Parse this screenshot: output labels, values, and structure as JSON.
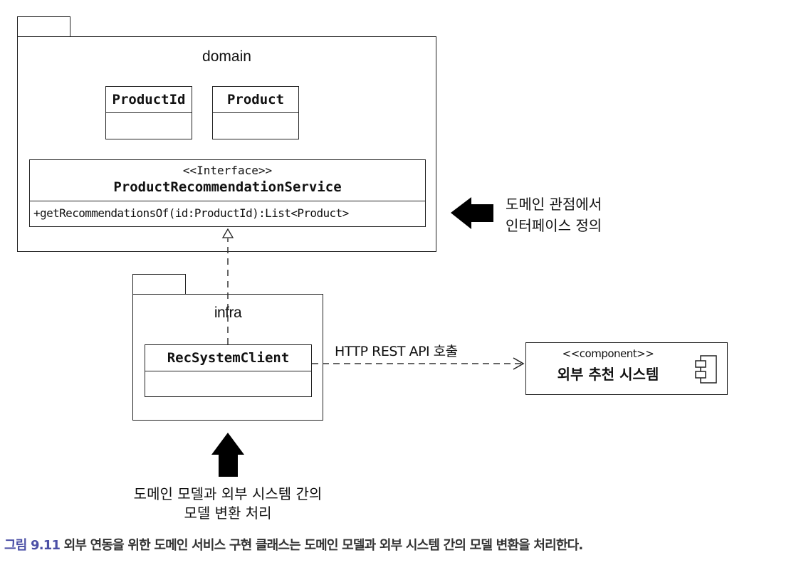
{
  "packages": {
    "domain": {
      "label": "domain"
    },
    "infra": {
      "label": "infra"
    }
  },
  "classes": {
    "product_id": {
      "name": "ProductId"
    },
    "product": {
      "name": "Product"
    },
    "service": {
      "stereotype": "<<Interface>>",
      "name": "ProductRecommendationService",
      "operation": "+getRecommendationsOf(id:ProductId):List<Product>"
    },
    "rec_client": {
      "name": "RecSystemClient"
    }
  },
  "component": {
    "stereotype": "<<component>>",
    "name": "외부 추천 시스템",
    "icon": "component-icon"
  },
  "connectors": {
    "http_label": "HTTP REST API 호출",
    "realization": "realization-arrow",
    "dependency": "dependency-arrow"
  },
  "annotations": {
    "interface_note": {
      "line1": "도메인 관점에서",
      "line2": "인터페이스 정의",
      "arrow": "left-arrow"
    },
    "conversion_note": {
      "line1": "도메인 모델과 외부 시스템 간의",
      "line2": "모델 변환 처리",
      "arrow": "up-arrow"
    }
  },
  "caption": {
    "label": "그림 9.11",
    "text": "외부 연동을 위한 도메인 서비스 구현 클래스는 도메인 모델과 외부 시스템 간의 모델 변환을 처리한다.",
    "label_color": "#4b4fa6"
  }
}
